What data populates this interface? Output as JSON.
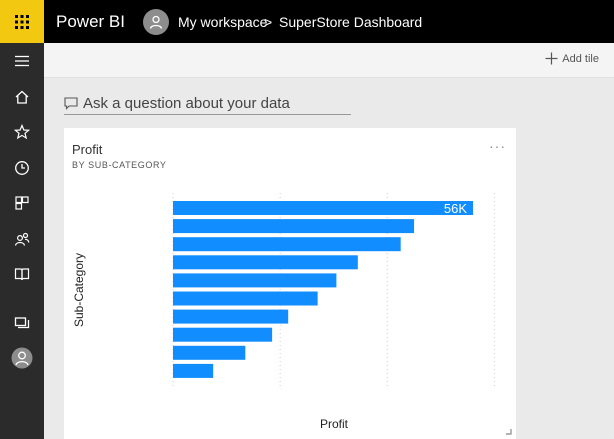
{
  "header": {
    "app_name": "Power BI",
    "workspace": "My workspace",
    "separator": ">",
    "dashboard": "SuperStore Dashboard"
  },
  "sidebar": {
    "items": [
      {
        "icon": "hamburger-icon"
      },
      {
        "icon": "home-icon"
      },
      {
        "icon": "favorites-star-icon"
      },
      {
        "icon": "recent-clock-icon"
      },
      {
        "icon": "apps-icon"
      },
      {
        "icon": "shared-people-icon"
      },
      {
        "icon": "workspaces-book-icon"
      },
      {
        "icon": "display-icon"
      },
      {
        "icon": "user-avatar-icon"
      }
    ]
  },
  "actionbar": {
    "add_tile": "Add tile"
  },
  "qna": {
    "placeholder": "Ask a question about your data"
  },
  "tile": {
    "title": "Profit",
    "subtitle": "BY SUB-CATEGORY",
    "more": "···"
  },
  "colors": {
    "accent": "#f2c811",
    "bar": "#118dff"
  },
  "chart_data": {
    "type": "bar",
    "orientation": "horizontal",
    "xlabel": "Profit",
    "ylabel": "Sub-Category",
    "xlim": [
      0,
      60000
    ],
    "grid": true,
    "data_labels": [
      "56K"
    ],
    "values": [
      56000,
      45000,
      42500,
      34500,
      30500,
      27000,
      21500,
      18500,
      13500,
      7500
    ]
  }
}
